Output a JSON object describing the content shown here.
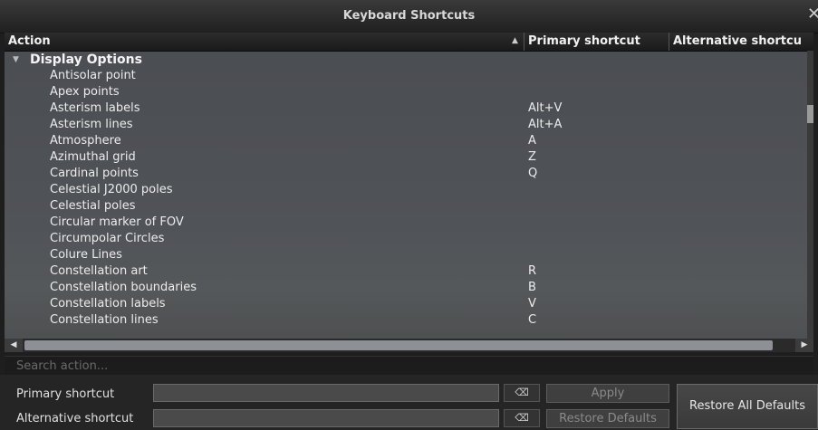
{
  "window": {
    "title": "Keyboard Shortcuts",
    "close_glyph": "✕"
  },
  "table": {
    "columns": {
      "action": "Action",
      "sort_indicator": "▲",
      "primary": "Primary shortcut",
      "alternative": "Alternative shortcu"
    },
    "group": {
      "expander": "▼",
      "label": "Display Options"
    },
    "rows": [
      {
        "action": "Antisolar point",
        "primary": ""
      },
      {
        "action": "Apex points",
        "primary": ""
      },
      {
        "action": "Asterism labels",
        "primary": "Alt+V"
      },
      {
        "action": "Asterism lines",
        "primary": "Alt+A"
      },
      {
        "action": "Atmosphere",
        "primary": "A"
      },
      {
        "action": "Azimuthal grid",
        "primary": "Z"
      },
      {
        "action": "Cardinal points",
        "primary": "Q"
      },
      {
        "action": "Celestial J2000 poles",
        "primary": ""
      },
      {
        "action": "Celestial poles",
        "primary": ""
      },
      {
        "action": "Circular marker of FOV",
        "primary": ""
      },
      {
        "action": "Circumpolar Circles",
        "primary": ""
      },
      {
        "action": "Colure Lines",
        "primary": ""
      },
      {
        "action": "Constellation art",
        "primary": "R"
      },
      {
        "action": "Constellation boundaries",
        "primary": "B"
      },
      {
        "action": "Constellation labels",
        "primary": "V"
      },
      {
        "action": "Constellation lines",
        "primary": "C"
      }
    ]
  },
  "scroll": {
    "left_glyph": "◀",
    "right_glyph": "▶"
  },
  "search": {
    "placeholder": "Search action..."
  },
  "form": {
    "primary_label": "Primary shortcut",
    "alternative_label": "Alternative shortcut",
    "clear_glyph": "⌫",
    "apply_label": "Apply",
    "restore_defaults_label": "Restore Defaults",
    "restore_all_label": "Restore All Defaults"
  }
}
